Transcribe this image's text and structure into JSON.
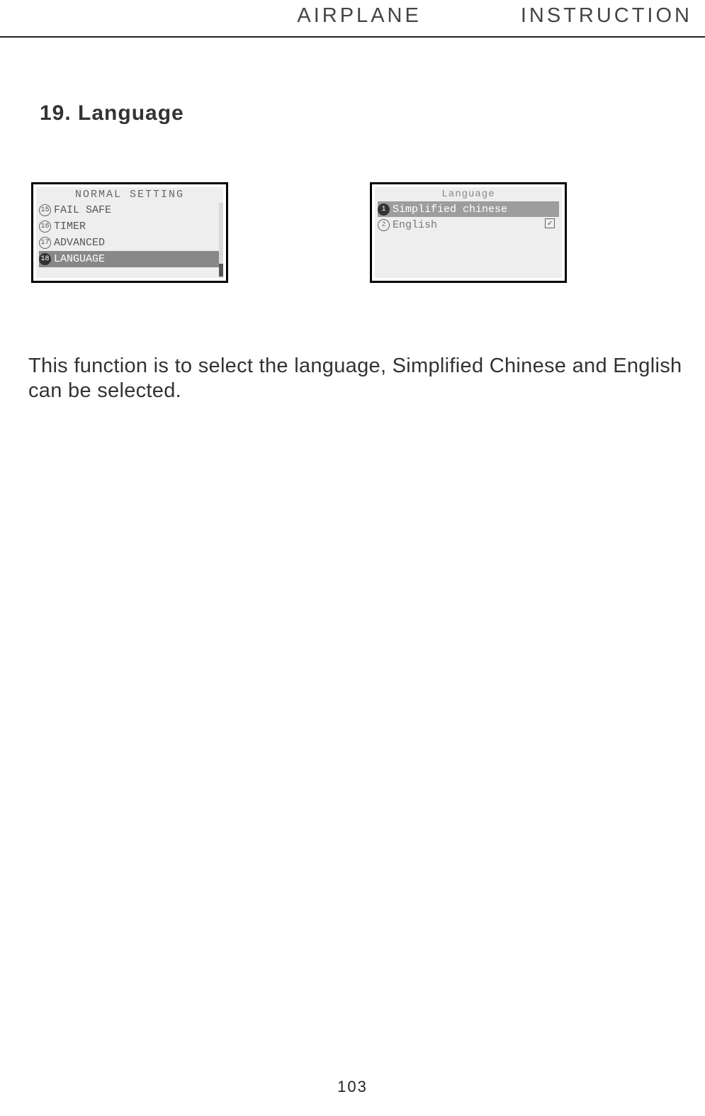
{
  "header": {
    "left": "AIRPLANE",
    "right": "INSTRUCTION"
  },
  "section": {
    "title": "19. Language"
  },
  "leftScreen": {
    "title": "NORMAL SETTING",
    "items": [
      {
        "num": "15",
        "label": "FAIL SAFE"
      },
      {
        "num": "16",
        "label": "TIMER"
      },
      {
        "num": "17",
        "label": "ADVANCED"
      },
      {
        "num": "18",
        "label": "LANGUAGE"
      }
    ]
  },
  "rightScreen": {
    "title": "Language",
    "items": [
      {
        "num": "1",
        "label": "Simplified chinese"
      },
      {
        "num": "2",
        "label": "English"
      }
    ]
  },
  "body": "This function is to select the language, Simplified Chinese and English can be selected.",
  "pageNumber": "103"
}
